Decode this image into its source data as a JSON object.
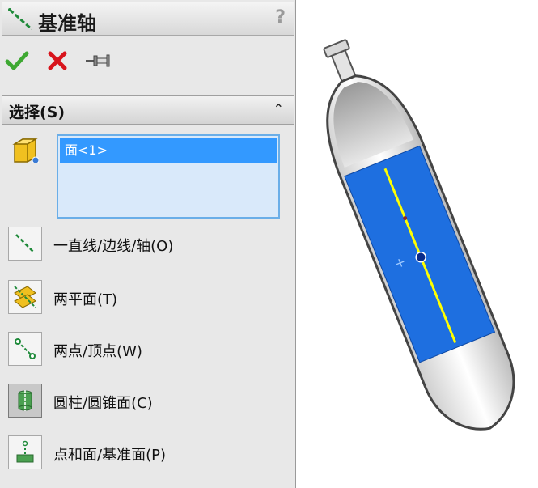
{
  "panel": {
    "title": "基准轴",
    "help": "?",
    "actions": {
      "ok_icon": "check-icon",
      "cancel_icon": "x-icon",
      "pin_icon": "pushpin-icon"
    },
    "section": {
      "title": "选择(S)",
      "collapse_icon": "double-chevron-up-icon"
    },
    "selection_box": {
      "items": [
        "面<1>"
      ]
    },
    "options": [
      {
        "label": "一直线/边线/轴(O)",
        "icon": "line-axis-icon",
        "pressed": false
      },
      {
        "label": "两平面(T)",
        "icon": "two-planes-icon",
        "pressed": false
      },
      {
        "label": "两点/顶点(W)",
        "icon": "two-points-icon",
        "pressed": false
      },
      {
        "label": "圆柱/圆锥面(C)",
        "icon": "cylinder-cone-icon",
        "pressed": true
      },
      {
        "label": "点和面/基准面(P)",
        "icon": "point-plane-icon",
        "pressed": false
      }
    ]
  },
  "colors": {
    "accent_blue": "#3399ff",
    "selection_bg": "#d9e9fa",
    "axis_yellow": "#ffff00",
    "model_blue": "#1e6fe0"
  }
}
